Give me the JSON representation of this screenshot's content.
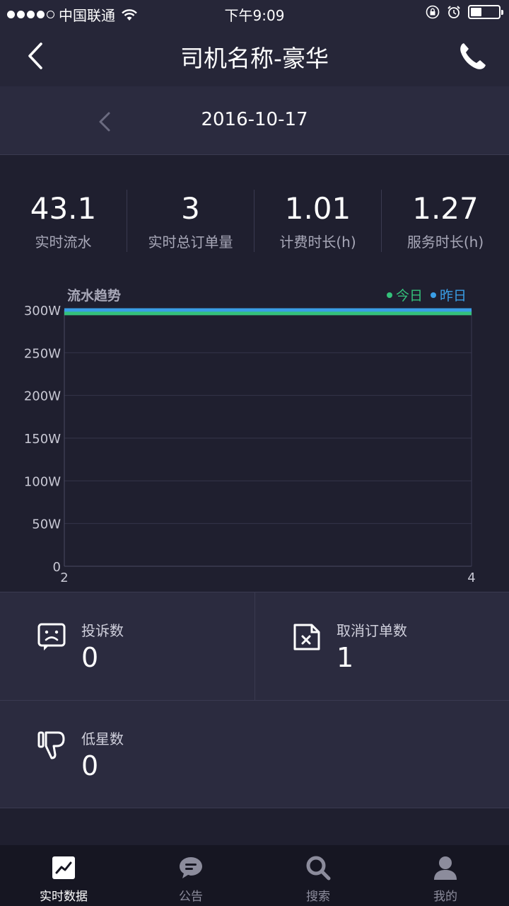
{
  "status_bar": {
    "carrier": "中国联通",
    "time": "下午9:09",
    "battery_level": 0.4
  },
  "nav": {
    "title": "司机名称-豪华"
  },
  "date": {
    "value": "2016-10-17"
  },
  "stats": [
    {
      "value": "43.1",
      "label": "实时流水"
    },
    {
      "value": "3",
      "label": "实时总订单量"
    },
    {
      "value": "1.01",
      "label": "计费时长(h)"
    },
    {
      "value": "1.27",
      "label": "服务时长(h)"
    }
  ],
  "chart_data": {
    "type": "line",
    "title": "流水趋势",
    "x": [
      2,
      4
    ],
    "xticks": [
      "2",
      "4"
    ],
    "yticks": [
      "0",
      "50W",
      "100W",
      "150W",
      "200W",
      "250W",
      "300W"
    ],
    "ylim": [
      0,
      300
    ],
    "series": [
      {
        "name": "今日",
        "color": "#34c17b",
        "values": [
          296,
          296
        ]
      },
      {
        "name": "昨日",
        "color": "#3a9ee6",
        "values": [
          300,
          300
        ]
      }
    ],
    "legend_position": "top-right",
    "grid": true
  },
  "cards": {
    "complaints": {
      "label": "投诉数",
      "value": "0"
    },
    "cancelled": {
      "label": "取消订单数",
      "value": "1"
    },
    "low_stars": {
      "label": "低星数",
      "value": "0"
    }
  },
  "tabs": [
    {
      "label": "实时数据",
      "icon": "realtime-chart-icon",
      "active": true
    },
    {
      "label": "公告",
      "icon": "announcement-icon",
      "active": false
    },
    {
      "label": "搜索",
      "icon": "search-icon",
      "active": false
    },
    {
      "label": "我的",
      "icon": "profile-icon",
      "active": false
    }
  ]
}
